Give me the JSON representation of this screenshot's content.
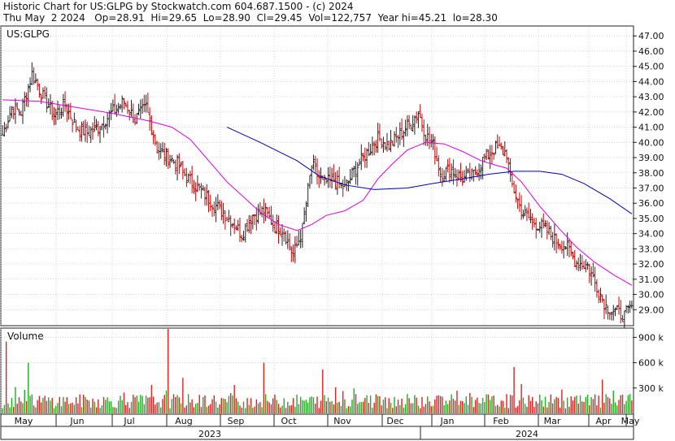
{
  "header": {
    "line1": "Historic Chart for US:GLPG by Stockwatch.com 604.687.1500 - (c) 2024",
    "line2": "Thu May  2 2024   Op=28.91  Hi=29.65  Lo=28.90  Cl=29.45  Vol=122,757  Year hi=45.21  lo=28.30"
  },
  "price_panel": {
    "symbol": "US:GLPG"
  },
  "volume_panel": {
    "label": "Volume"
  },
  "colors": {
    "up": "#222222",
    "down": "#cc0000",
    "ma_short": "#dd00dd",
    "ma_long": "#0000bb",
    "vol_up": "#22aa22",
    "vol_down": "#dd2222",
    "grid": "#bbbbbb"
  },
  "chart_data": [
    {
      "type": "ohlc",
      "title": "US:GLPG",
      "y_ticks": [
        29,
        30,
        31,
        32,
        33,
        34,
        35,
        36,
        37,
        38,
        39,
        40,
        41,
        42,
        43,
        44,
        45,
        46,
        47
      ],
      "y_tick_labels": [
        "29.00",
        "30.00",
        "31.00",
        "32.00",
        "33.00",
        "34.00",
        "35.00",
        "36.00",
        "37.00",
        "38.00",
        "39.00",
        "40.00",
        "41.00",
        "42.00",
        "43.00",
        "44.00",
        "45.00",
        "46.00",
        "47.00"
      ],
      "ylim": [
        28.0,
        47.6
      ],
      "x_months": [
        "May",
        "Jun",
        "Jul",
        "Aug",
        "Sep",
        "Oct",
        "Nov",
        "Dec",
        "Jan",
        "Feb",
        "Mar",
        "Apr",
        "May"
      ],
      "x_years": [
        "2023",
        "2024"
      ],
      "series": [
        {
          "kind": "price",
          "anchors": [
            [
              0,
              40.5
            ],
            [
              5,
              42.3
            ],
            [
              10,
              42.0
            ],
            [
              16,
              44.5
            ],
            [
              22,
              43.0
            ],
            [
              28,
              41.8
            ],
            [
              34,
              42.5
            ],
            [
              40,
              41.0
            ],
            [
              46,
              40.6
            ],
            [
              52,
              41.0
            ],
            [
              60,
              42.0
            ],
            [
              66,
              42.7
            ],
            [
              72,
              41.5
            ],
            [
              78,
              42.3
            ],
            [
              84,
              39.6
            ],
            [
              90,
              39.0
            ],
            [
              95,
              38.6
            ],
            [
              100,
              37.7
            ],
            [
              106,
              37.0
            ],
            [
              112,
              36.3
            ],
            [
              118,
              35.6
            ],
            [
              124,
              34.9
            ],
            [
              130,
              34.0
            ],
            [
              136,
              35.2
            ],
            [
              142,
              35.5
            ],
            [
              148,
              34.5
            ],
            [
              153,
              34.2
            ],
            [
              158,
              32.5
            ],
            [
              163,
              34.3
            ],
            [
              168,
              38.5
            ],
            [
              174,
              37.3
            ],
            [
              180,
              37.5
            ],
            [
              186,
              37.0
            ],
            [
              192,
              38.3
            ],
            [
              198,
              39.3
            ],
            [
              204,
              40.3
            ],
            [
              210,
              39.8
            ],
            [
              216,
              40.5
            ],
            [
              222,
              41.3
            ],
            [
              226,
              42.0
            ],
            [
              230,
              40.5
            ],
            [
              234,
              39.8
            ],
            [
              238,
              38.0
            ],
            [
              244,
              38.2
            ],
            [
              250,
              37.6
            ],
            [
              256,
              37.9
            ],
            [
              262,
              39.0
            ],
            [
              268,
              39.6
            ],
            [
              274,
              39.3
            ],
            [
              276,
              37.5
            ],
            [
              282,
              35.5
            ],
            [
              288,
              34.8
            ],
            [
              294,
              34.4
            ],
            [
              300,
              33.6
            ],
            [
              306,
              33.2
            ],
            [
              312,
              32.1
            ],
            [
              318,
              31.9
            ],
            [
              322,
              30.8
            ],
            [
              328,
              29.2
            ],
            [
              334,
              28.8
            ],
            [
              338,
              28.6
            ],
            [
              342,
              29.2
            ]
          ]
        },
        {
          "kind": "ma_short",
          "anchors": [
            [
              0,
              42.8
            ],
            [
              20,
              42.7
            ],
            [
              40,
              42.3
            ],
            [
              60,
              41.9
            ],
            [
              80,
              41.4
            ],
            [
              92,
              41.0
            ],
            [
              102,
              40.2
            ],
            [
              112,
              38.8
            ],
            [
              122,
              37.4
            ],
            [
              132,
              36.3
            ],
            [
              140,
              35.4
            ],
            [
              150,
              34.6
            ],
            [
              160,
              34.2
            ],
            [
              168,
              34.6
            ],
            [
              176,
              35.2
            ],
            [
              186,
              35.5
            ],
            [
              196,
              36.2
            ],
            [
              204,
              37.6
            ],
            [
              212,
              38.6
            ],
            [
              220,
              39.5
            ],
            [
              230,
              40.0
            ],
            [
              240,
              39.9
            ],
            [
              250,
              39.4
            ],
            [
              260,
              38.8
            ],
            [
              268,
              38.5
            ],
            [
              274,
              38.3
            ],
            [
              282,
              37.4
            ],
            [
              292,
              35.8
            ],
            [
              302,
              34.4
            ],
            [
              312,
              33.1
            ],
            [
              322,
              32.1
            ],
            [
              332,
              31.3
            ],
            [
              342,
              30.6
            ]
          ]
        },
        {
          "kind": "ma_long",
          "anchors": [
            [
              122,
              41.0
            ],
            [
              140,
              40.0
            ],
            [
              160,
              38.8
            ],
            [
              172,
              37.8
            ],
            [
              186,
              37.2
            ],
            [
              202,
              36.9
            ],
            [
              220,
              37.0
            ],
            [
              234,
              37.3
            ],
            [
              250,
              37.6
            ],
            [
              264,
              37.9
            ],
            [
              278,
              38.1
            ],
            [
              292,
              38.1
            ],
            [
              304,
              37.9
            ],
            [
              316,
              37.3
            ],
            [
              330,
              36.3
            ],
            [
              342,
              35.3
            ]
          ]
        }
      ]
    },
    {
      "type": "bar",
      "title": "Volume",
      "y_ticks": [
        300000,
        600000,
        900000
      ],
      "y_tick_labels": [
        "300 k",
        "600 k",
        "900 k"
      ],
      "ylim": [
        0,
        1000000
      ],
      "notable_spikes": [
        [
          2,
          850000
        ],
        [
          14,
          600000
        ],
        [
          90,
          1000000
        ],
        [
          98,
          420000
        ],
        [
          142,
          600000
        ],
        [
          174,
          520000
        ],
        [
          278,
          550000
        ],
        [
          326,
          400000
        ]
      ]
    }
  ]
}
